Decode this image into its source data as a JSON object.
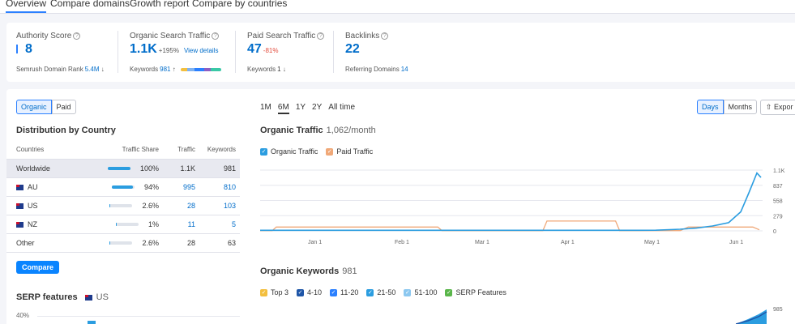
{
  "tabs": [
    "Overview",
    "Compare domains",
    "Growth report",
    "Compare by countries"
  ],
  "kpis": {
    "authority": {
      "label": "Authority Score",
      "value": "8",
      "sub_label": "Semrush Domain Rank",
      "sub_value": "5.4M",
      "sub_arrow": "↓"
    },
    "organic": {
      "label": "Organic Search Traffic",
      "value": "1.1K",
      "delta": "+195%",
      "link": "View details",
      "sub_label": "Keywords",
      "sub_value": "981",
      "sub_arrow": "↑"
    },
    "paid": {
      "label": "Paid Search Traffic",
      "value": "47",
      "delta": "-81%",
      "sub_label": "Keywords",
      "sub_value": "1",
      "sub_arrow": "↓"
    },
    "backlinks": {
      "label": "Backlinks",
      "value": "22",
      "sub_label": "Referring Domains",
      "sub_value": "14"
    }
  },
  "keyword_dist_colors": [
    "#f3bf3e",
    "#7fb2f0",
    "#2b80ff",
    "#8e5ec2",
    "#3ac8a6"
  ],
  "toggle": {
    "organic": "Organic",
    "paid": "Paid"
  },
  "distribution": {
    "title": "Distribution by Country",
    "headers": {
      "country": "Countries",
      "share": "Traffic Share",
      "traffic": "Traffic",
      "keywords": "Keywords"
    },
    "rows": [
      {
        "country": "Worldwide",
        "share": "100%",
        "share_frac": 1.0,
        "traffic": "1.1K",
        "keywords": "981",
        "flag": false,
        "link": false
      },
      {
        "country": "AU",
        "share": "94%",
        "share_frac": 0.94,
        "traffic": "995",
        "keywords": "810",
        "flag": true,
        "link": true
      },
      {
        "country": "US",
        "share": "2.6%",
        "share_frac": 0.026,
        "traffic": "28",
        "keywords": "103",
        "flag": true,
        "link": true
      },
      {
        "country": "NZ",
        "share": "1%",
        "share_frac": 0.01,
        "traffic": "11",
        "keywords": "5",
        "flag": true,
        "link": true
      },
      {
        "country": "Other",
        "share": "2.6%",
        "share_frac": 0.026,
        "traffic": "28",
        "keywords": "63",
        "flag": false,
        "link": false
      }
    ]
  },
  "compare_button": "Compare",
  "serp": {
    "title": "SERP features",
    "country": "US",
    "ytick": "40%"
  },
  "ranges": [
    "1M",
    "6M",
    "1Y",
    "2Y",
    "All time"
  ],
  "granularity": {
    "days": "Days",
    "months": "Months"
  },
  "export_label": "Expor",
  "traffic_chart": {
    "title": "Organic Traffic",
    "subtitle": "1,062/month",
    "legend": {
      "organic": "Organic Traffic",
      "paid": "Paid Traffic"
    },
    "colors": {
      "organic": "#2b9de0",
      "paid": "#f0a878",
      "grid": "#e6e7ee"
    }
  },
  "keywords_chart": {
    "title": "Organic Keywords",
    "subtitle": "981",
    "legend": [
      "Top 3",
      "4-10",
      "11-20",
      "21-50",
      "51-100",
      "SERP Features"
    ],
    "legend_colors": [
      "#f3bf3e",
      "#1f56a8",
      "#2b80ff",
      "#2b9de0",
      "#8cc8f0",
      "#5ab64a"
    ],
    "ytick": "985"
  },
  "chart_data": {
    "type": "line",
    "x_labels": [
      "Jan 1",
      "Feb 1",
      "Mar 1",
      "Apr 1",
      "May 1",
      "Jun 1"
    ],
    "y_ticks": [
      "1.1K",
      "837",
      "558",
      "279",
      "0"
    ],
    "ylim": [
      0,
      1116
    ],
    "series": [
      {
        "name": "Organic Traffic",
        "points": [
          [
            0,
            10
          ],
          [
            60,
            10
          ],
          [
            120,
            10
          ],
          [
            180,
            10
          ],
          [
            240,
            10
          ],
          [
            300,
            10
          ],
          [
            360,
            10
          ],
          [
            420,
            10
          ],
          [
            470,
            10
          ],
          [
            490,
            12
          ],
          [
            520,
            30
          ],
          [
            540,
            50
          ],
          [
            560,
            90
          ],
          [
            580,
            150
          ],
          [
            595,
            350
          ],
          [
            605,
            700
          ],
          [
            615,
            1062
          ],
          [
            620,
            980
          ]
        ]
      },
      {
        "name": "Paid Traffic",
        "points": [
          [
            0,
            5
          ],
          [
            15,
            5
          ],
          [
            20,
            70
          ],
          [
            220,
            70
          ],
          [
            225,
            5
          ],
          [
            350,
            5
          ],
          [
            355,
            180
          ],
          [
            440,
            180
          ],
          [
            445,
            5
          ],
          [
            520,
            5
          ],
          [
            530,
            70
          ],
          [
            560,
            70
          ],
          [
            610,
            70
          ],
          [
            618,
            20
          ]
        ]
      }
    ]
  }
}
